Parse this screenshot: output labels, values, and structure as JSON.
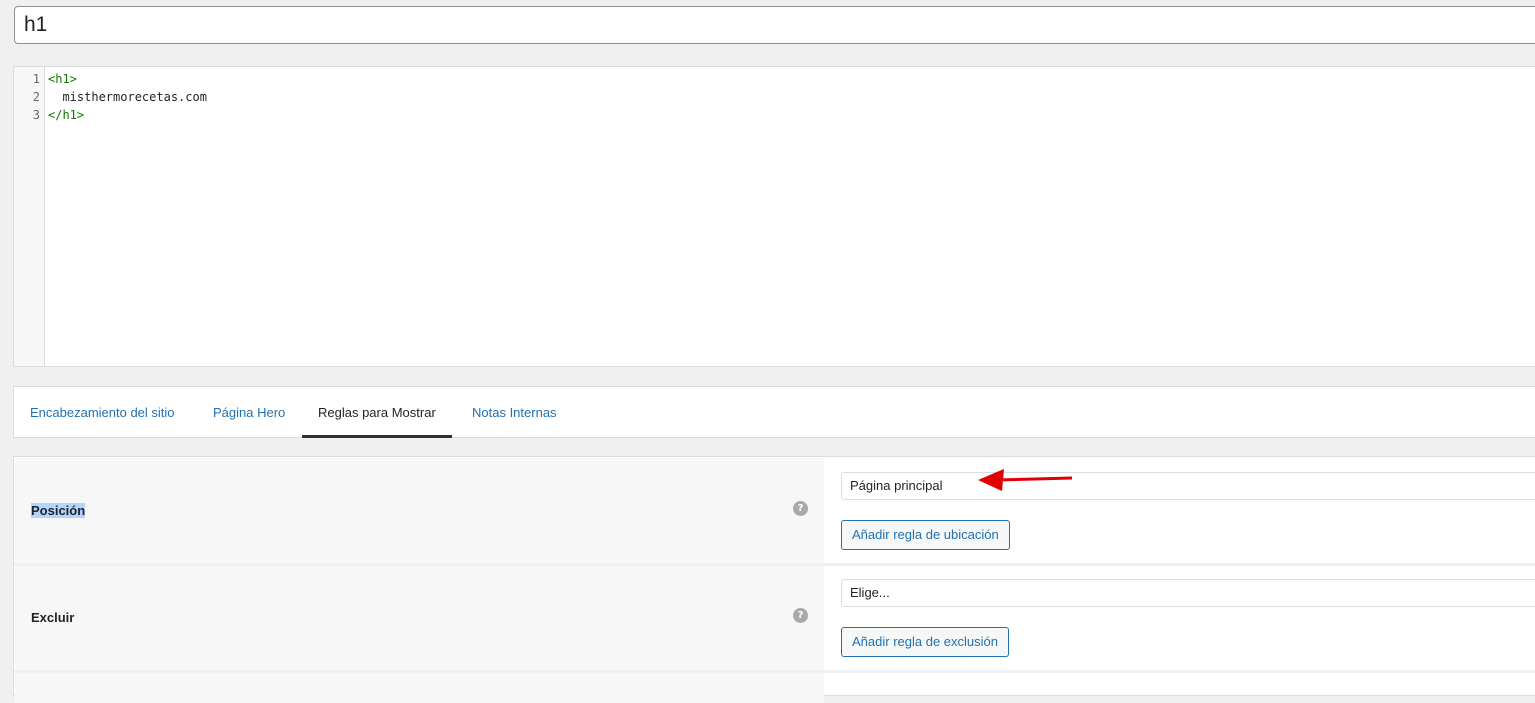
{
  "title_input": {
    "value": "h1"
  },
  "code_editor": {
    "lines": [
      {
        "number": "1",
        "text": "<h1>"
      },
      {
        "number": "2",
        "text": "  misthermorecetas.com"
      },
      {
        "number": "3",
        "text": "</h1>"
      }
    ]
  },
  "tabs": [
    {
      "label": "Encabezamiento del sitio",
      "active": false
    },
    {
      "label": "Página Hero",
      "active": false
    },
    {
      "label": "Reglas para Mostrar",
      "active": true
    },
    {
      "label": "Notas Internas",
      "active": false
    }
  ],
  "rules": {
    "position": {
      "label": "Posición",
      "help": "?",
      "select_value": "Página principal",
      "button_label": "Añadir regla de ubicación"
    },
    "exclude": {
      "label": "Excluir",
      "help": "?",
      "select_value": "Elige...",
      "button_label": "Añadir regla de exclusión"
    }
  },
  "colors": {
    "link": "#2271b1",
    "code_tag": "#117700",
    "annotation_arrow": "#e00000",
    "highlight": "#b3d4fc"
  }
}
